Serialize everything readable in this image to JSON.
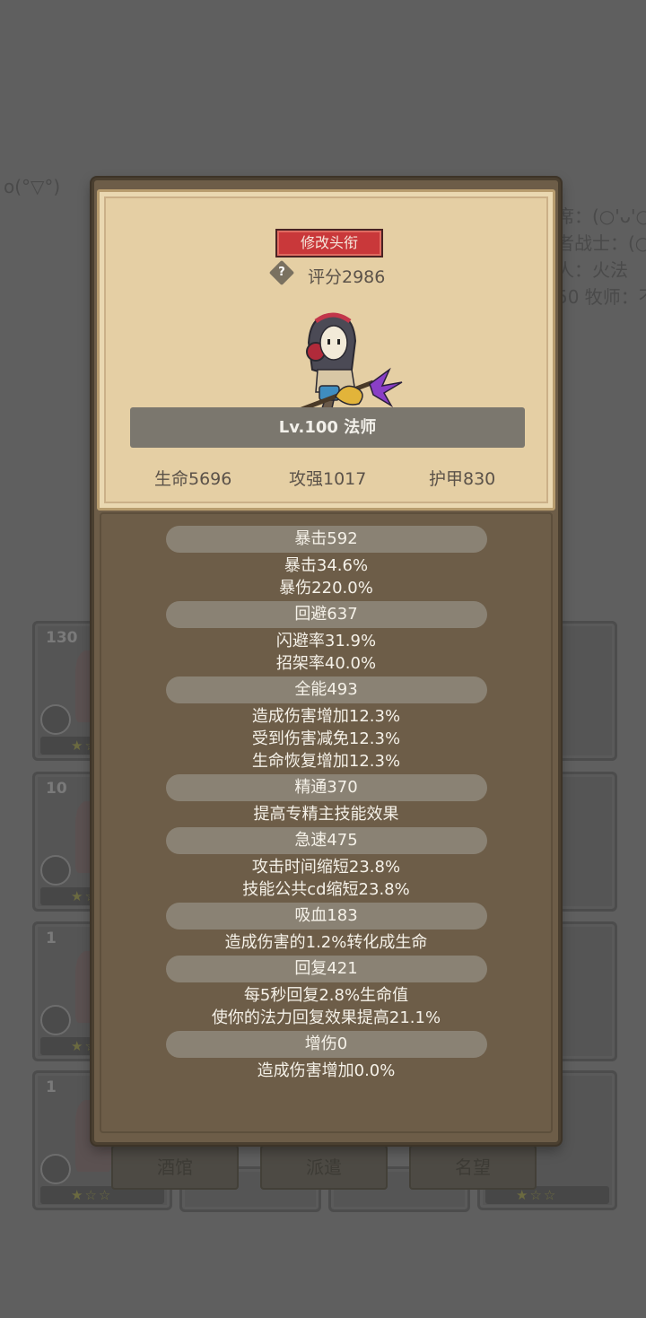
{
  "background": {
    "left_text": "o(°▽°)",
    "right_lines": [
      "席：(○'ᴗ'○",
      "者战士：(○",
      "人：火法",
      "50 牧师：不"
    ],
    "cards": [
      {
        "level": "130"
      },
      {
        "level": "10"
      },
      {
        "level": "1"
      },
      {
        "level": "1"
      }
    ],
    "tabs": [
      "酒馆",
      "派遣",
      "名望"
    ]
  },
  "modal": {
    "rename_button": "修改头衔",
    "help_icon": "?",
    "score": "评分2986",
    "level_class": "Lv.100 法师",
    "base_stats": [
      "生命5696",
      "攻强1017",
      "护甲830"
    ],
    "stat_groups": [
      {
        "header": "暴击592",
        "lines": [
          "暴击34.6%",
          "暴伤220.0%"
        ]
      },
      {
        "header": "回避637",
        "lines": [
          "闪避率31.9%",
          "招架率40.0%"
        ]
      },
      {
        "header": "全能493",
        "lines": [
          "造成伤害增加12.3%",
          "受到伤害减免12.3%",
          "生命恢复增加12.3%"
        ]
      },
      {
        "header": "精通370",
        "lines": [
          "提高专精主技能效果"
        ]
      },
      {
        "header": "急速475",
        "lines": [
          "攻击时间缩短23.8%",
          "技能公共cd缩短23.8%"
        ]
      },
      {
        "header": "吸血183",
        "lines": [
          "造成伤害的1.2%转化成生命"
        ]
      },
      {
        "header": "回复421",
        "lines": [
          "每5秒回复2.8%生命值",
          "使你的法力回复效果提高21.1%"
        ]
      },
      {
        "header": "增伤0",
        "lines": [
          "造成伤害增加0.0%"
        ]
      }
    ]
  }
}
